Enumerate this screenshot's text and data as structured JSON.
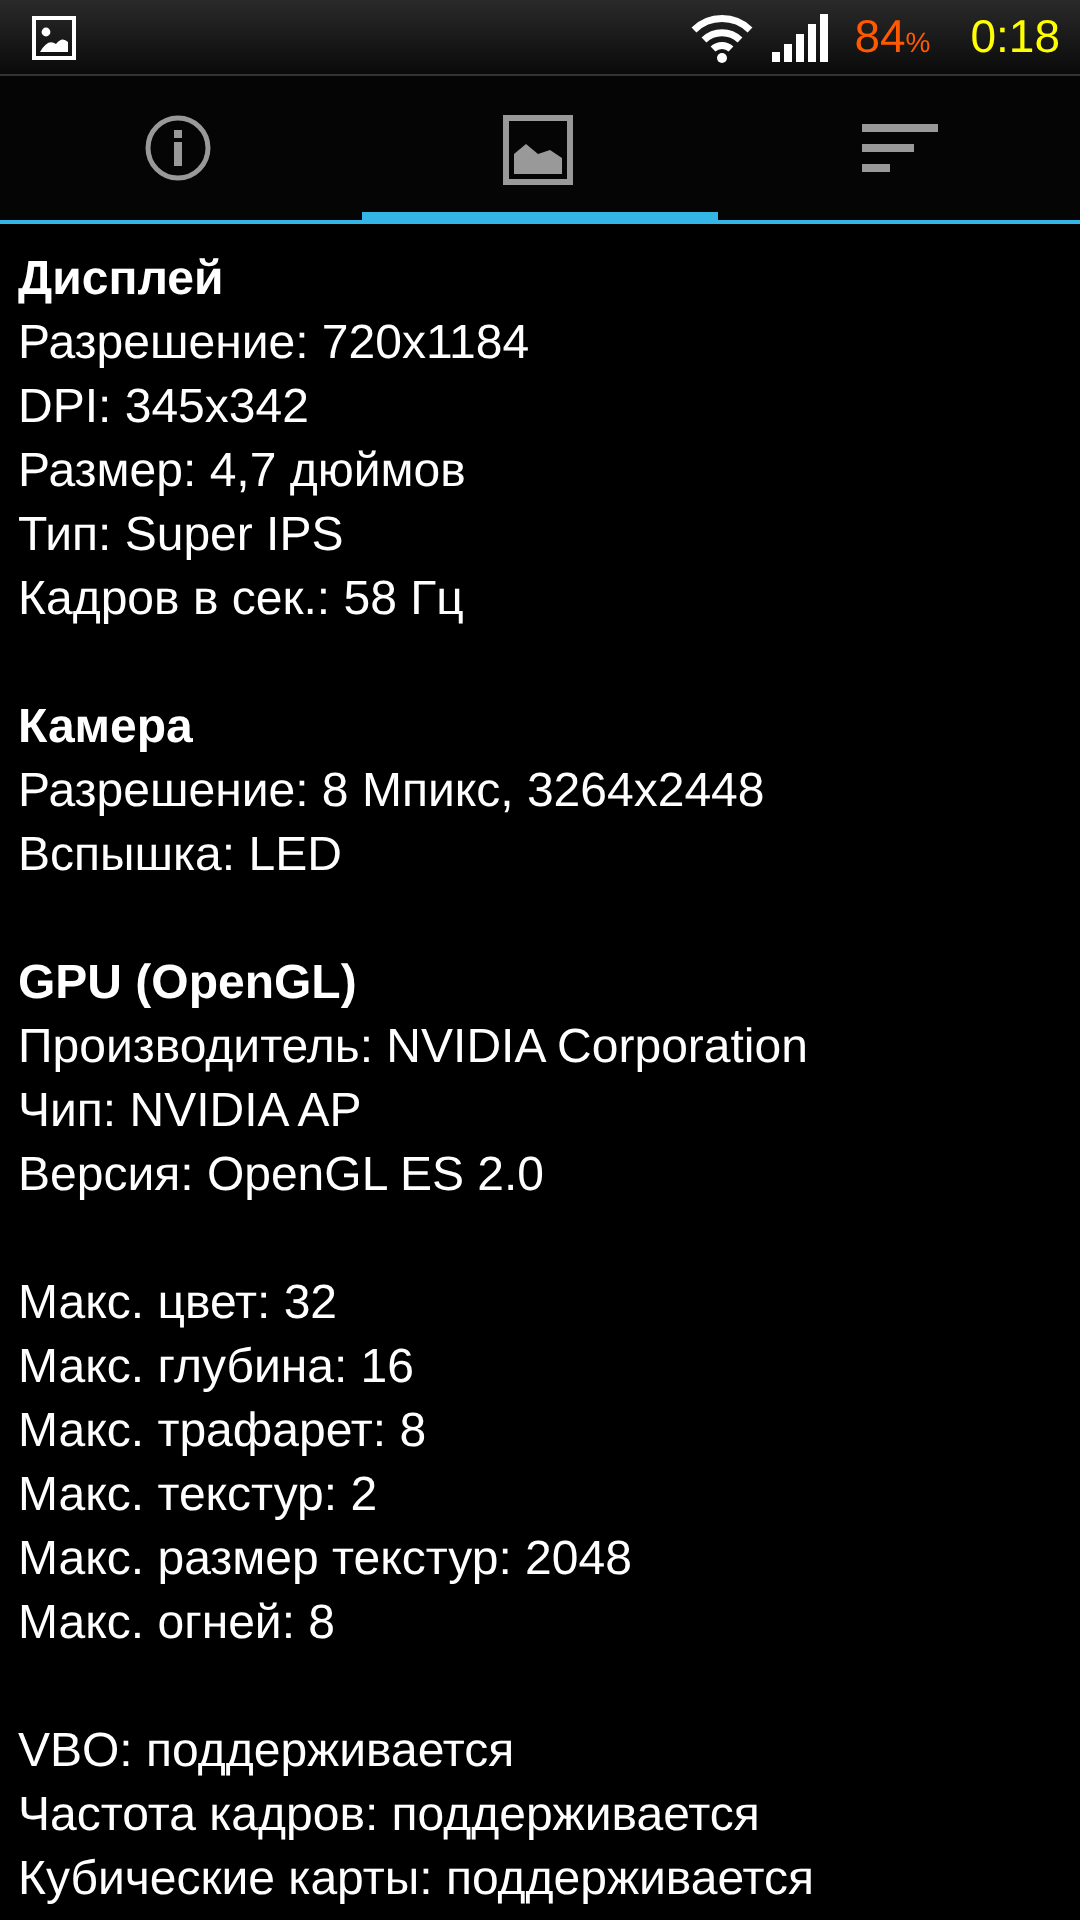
{
  "status_bar": {
    "battery": "84",
    "battery_unit": "%",
    "time": "0:18"
  },
  "tabs": [
    {
      "kind": "info",
      "selected": false
    },
    {
      "kind": "image",
      "selected": true
    },
    {
      "kind": "list",
      "selected": false
    }
  ],
  "sections": [
    {
      "title": "Дисплей",
      "lines": [
        "Разрешение: 720x1184",
        "DPI: 345x342",
        "Размер: 4,7 дюймов",
        "Тип: Super IPS",
        "Кадров в сек.: 58 Гц"
      ]
    },
    {
      "title": "Камера",
      "lines": [
        "Разрешение: 8 Мпикс, 3264x2448",
        "Вспышка: LED"
      ]
    },
    {
      "title": "GPU (OpenGL)",
      "lines": [
        "Производитель: NVIDIA Corporation",
        "Чип: NVIDIA AP",
        "Версия: OpenGL ES 2.0"
      ]
    },
    {
      "lines": [
        "Макс. цвет: 32",
        "Макс. глубина: 16",
        "Макс. трафарет: 8",
        "Макс. текстур: 2",
        "Макс. размер текстур: 2048",
        "Макс. огней: 8"
      ]
    },
    {
      "lines": [
        "VBO: поддерживается",
        "Частота кадров: поддерживается",
        "Кубические карты: поддерживается"
      ]
    }
  ]
}
